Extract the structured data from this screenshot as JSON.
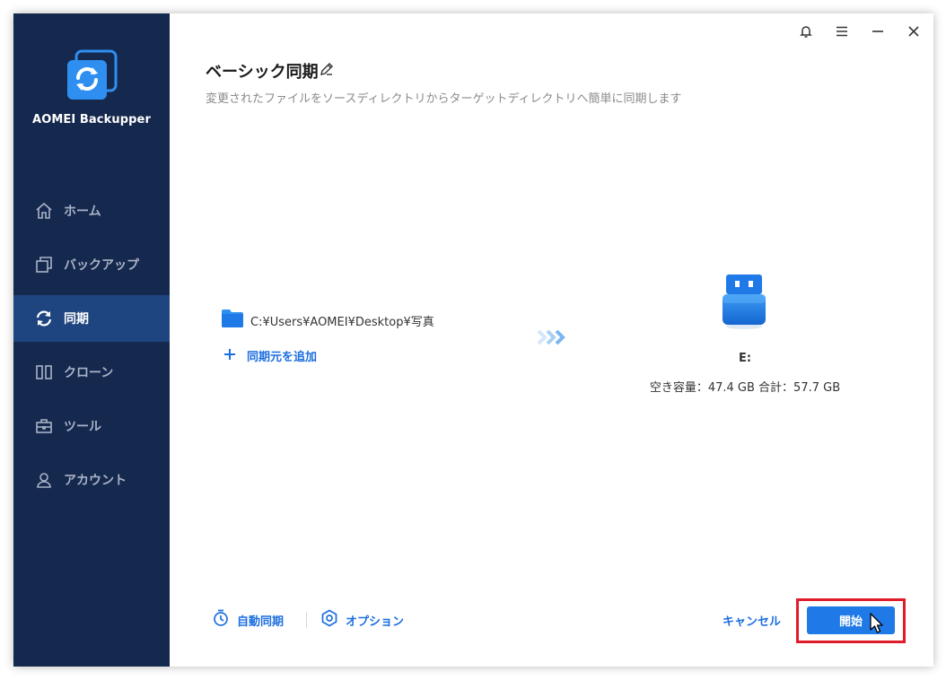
{
  "app": {
    "name": "AOMEI Backupper"
  },
  "sidebar": {
    "items": [
      {
        "label": "ホーム",
        "icon": "home-icon",
        "active": false
      },
      {
        "label": "バックアップ",
        "icon": "backup-icon",
        "active": false
      },
      {
        "label": "同期",
        "icon": "sync-icon",
        "active": true
      },
      {
        "label": "クローン",
        "icon": "clone-icon",
        "active": false
      },
      {
        "label": "ツール",
        "icon": "tools-icon",
        "active": false
      },
      {
        "label": "アカウント",
        "icon": "account-icon",
        "active": false
      }
    ]
  },
  "titlebar": {
    "icons": [
      "bell-icon",
      "menu-icon",
      "minimize-icon",
      "close-icon"
    ]
  },
  "main": {
    "title": "ベーシック同期",
    "subtitle": "変更されたファイルをソースディレクトリからターゲットディレクトリへ簡単に同期します",
    "source": {
      "path": "C:¥Users¥AOMEI¥Desktop¥写真",
      "add_label": "同期元を追加"
    },
    "target": {
      "drive_letter": "E:",
      "capacity": "空き容量：47.4 GB 合計：57.7 GB"
    }
  },
  "footer": {
    "schedule_label": "自動同期",
    "options_label": "オプション",
    "cancel_label": "キャンセル",
    "start_label": "開始"
  },
  "colors": {
    "sidebar_bg": "#15284e",
    "sidebar_active": "#1f4580",
    "accent": "#1f79e6",
    "highlight": "#e01b2a"
  }
}
